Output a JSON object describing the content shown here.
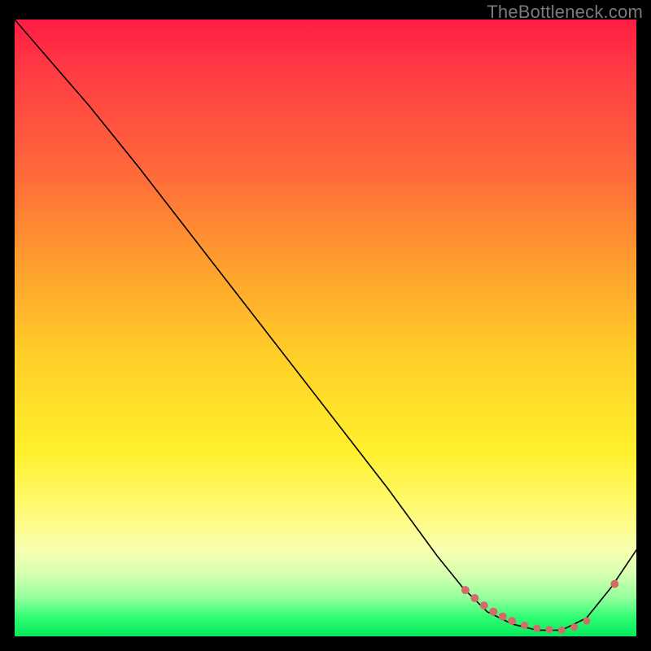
{
  "watermark": "TheBottleneck.com",
  "colors": {
    "background": "#000000",
    "gradient_top": "#ff1b44",
    "gradient_bottom": "#07e85c",
    "line": "#000000",
    "marker": "#d46a6a"
  },
  "chart_data": {
    "type": "line",
    "title": "",
    "xlabel": "",
    "ylabel": "",
    "xlim": [
      0,
      100
    ],
    "ylim": [
      0,
      100
    ],
    "grid": false,
    "legend": false,
    "series": [
      {
        "name": "bottleneck-curve",
        "x": [
          0,
          6,
          12,
          20,
          30,
          40,
          50,
          60,
          68,
          72,
          76,
          80,
          84,
          88,
          92,
          96,
          100
        ],
        "y": [
          100,
          93,
          86,
          76,
          63,
          50,
          37,
          24,
          13,
          8,
          4,
          2,
          1,
          1,
          3,
          8,
          14
        ]
      }
    ],
    "markers": {
      "name": "highlighted-points",
      "x": [
        72.5,
        74,
        75.5,
        77,
        78.5,
        80,
        82,
        84,
        86,
        88,
        90,
        92,
        96.5
      ],
      "y": [
        7.5,
        6.2,
        5.0,
        4.0,
        3.2,
        2.5,
        1.8,
        1.3,
        1.1,
        1.0,
        1.5,
        2.5,
        8.5
      ],
      "r": [
        5,
        5,
        5,
        5,
        5,
        5,
        4.5,
        4.5,
        4.5,
        4.5,
        4.5,
        4.5,
        5
      ]
    }
  }
}
